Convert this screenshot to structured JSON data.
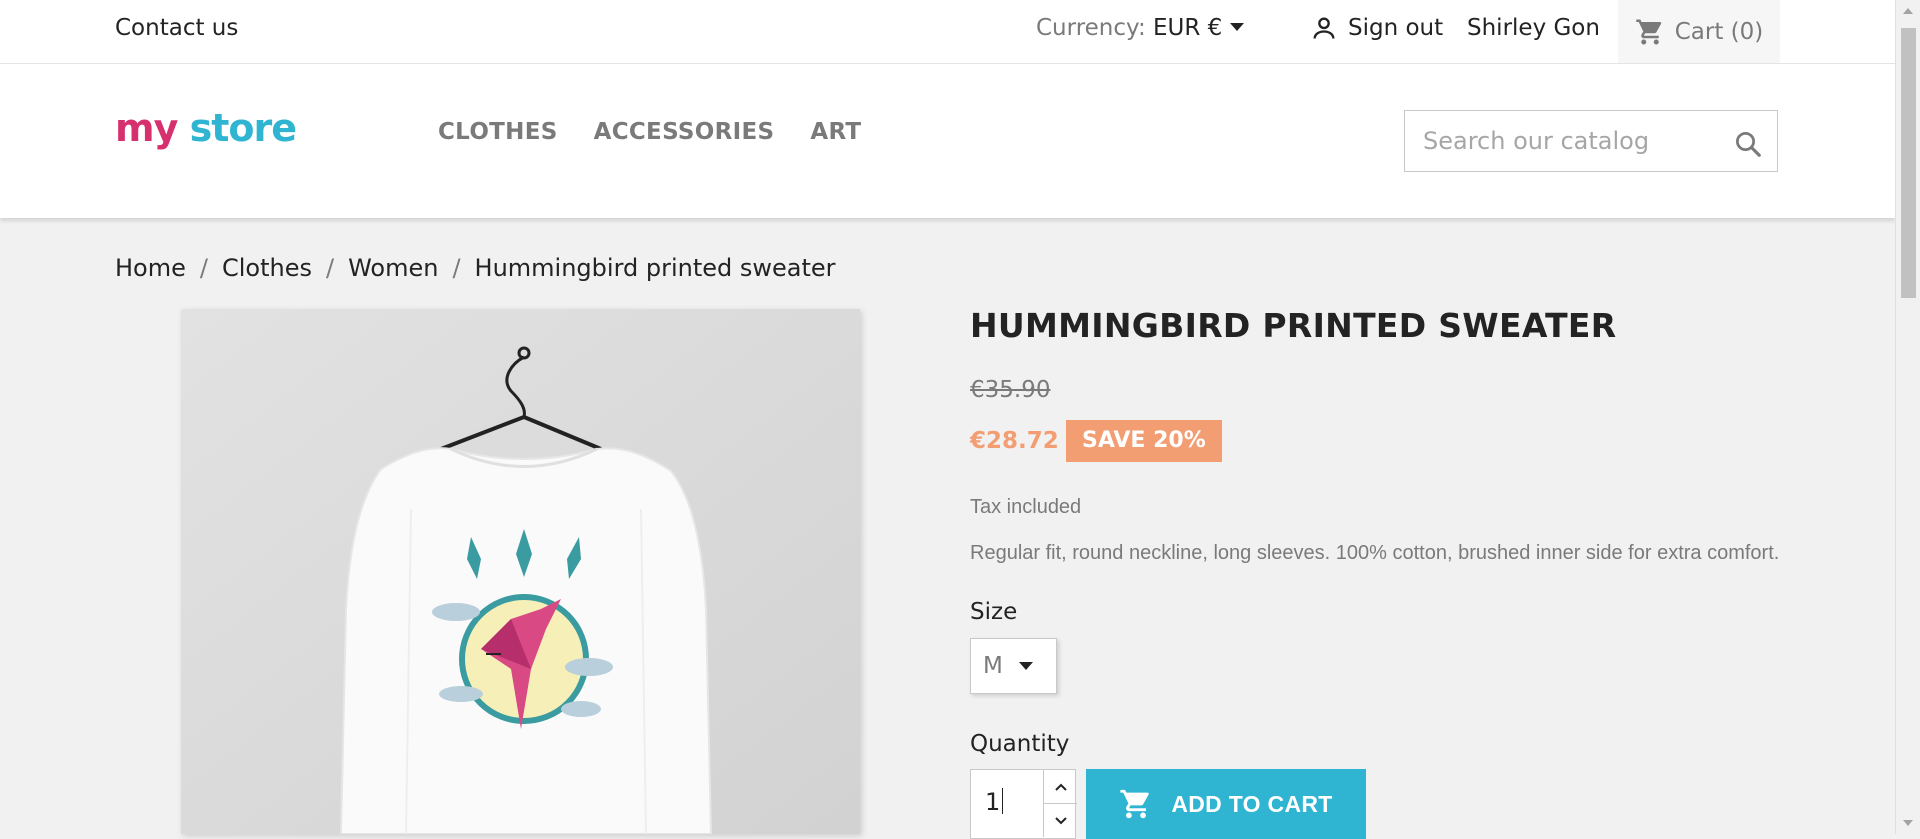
{
  "topbar": {
    "contact": "Contact us",
    "currency_label": "Currency:",
    "currency_value": "EUR €",
    "sign_out": "Sign out",
    "user_name": "Shirley Gon",
    "cart": "Cart (0)"
  },
  "header": {
    "logo_word1": "my",
    "logo_word2": "store",
    "nav": [
      "CLOTHES",
      "ACCESSORIES",
      "ART"
    ],
    "search_placeholder": "Search our catalog"
  },
  "breadcrumb": [
    "Home",
    "Clothes",
    "Women",
    "Hummingbird printed sweater"
  ],
  "product": {
    "title": "HUMMINGBIRD PRINTED SWEATER",
    "old_price": "€35.90",
    "price": "€28.72",
    "discount": "SAVE 20%",
    "tax": "Tax included",
    "description": "Regular fit, round neckline, long sleeves. 100% cotton, brushed inner side for extra comfort.",
    "size_label": "Size",
    "size_value": "M",
    "quantity_label": "Quantity",
    "quantity_value": "1",
    "add_to_cart": "ADD TO CART"
  },
  "colors": {
    "accent": "#2fb5d2",
    "sale": "#f39d72"
  }
}
